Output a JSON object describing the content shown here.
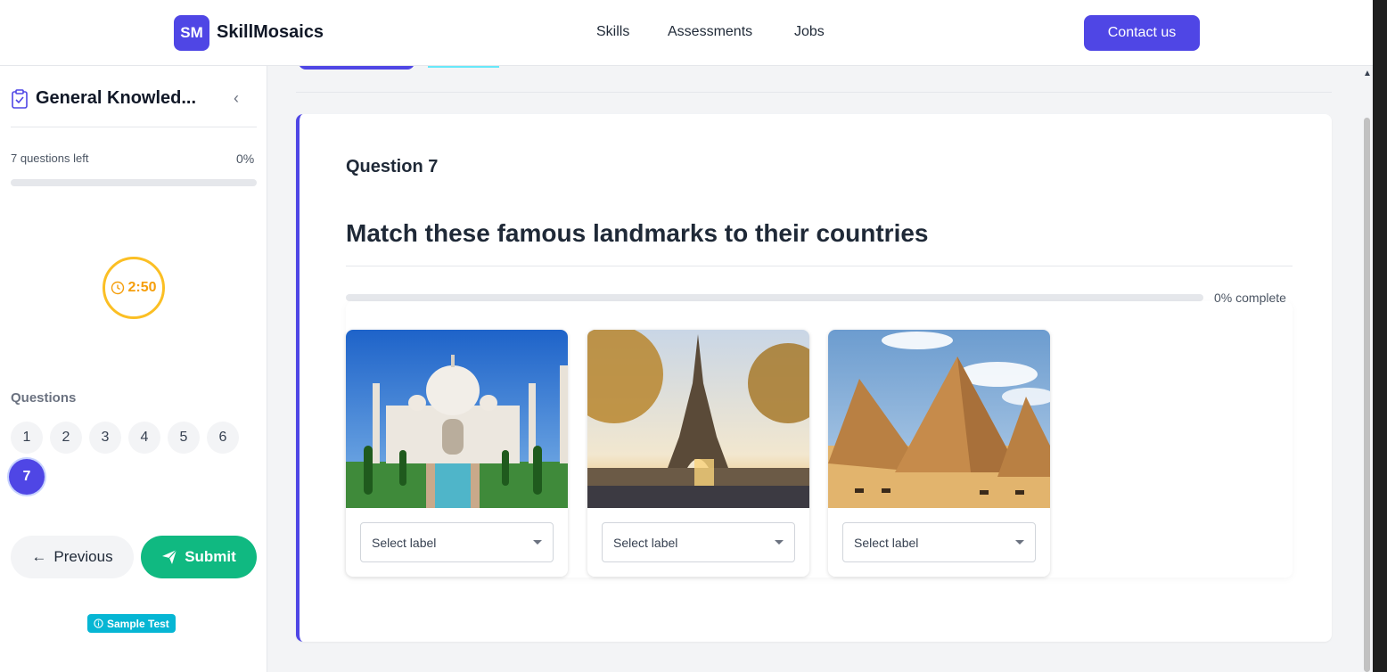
{
  "header": {
    "logo_initials": "SM",
    "brand": "SkillMosaics",
    "nav": {
      "skills": "Skills",
      "assessments": "Assessments",
      "jobs": "Jobs"
    },
    "contact_label": "Contact us"
  },
  "sidebar": {
    "test_title": "General Knowled...",
    "questions_left": "7 questions left",
    "percent": "0%",
    "progress_fraction": 0,
    "timer": "2:50",
    "questions_label": "Questions",
    "question_numbers": [
      "1",
      "2",
      "3",
      "4",
      "5",
      "6",
      "7"
    ],
    "active_question": "7",
    "previous_label": "Previous",
    "submit_label": "Submit",
    "sample_badge": "Sample Test"
  },
  "question": {
    "heading": "Question 7",
    "text": "Match these famous landmarks to their countries",
    "progress_label": "0% complete",
    "progress_fraction": 0,
    "items": [
      {
        "image": "taj-mahal",
        "select_placeholder": "Select label"
      },
      {
        "image": "eiffel-tower",
        "select_placeholder": "Select label"
      },
      {
        "image": "pyramids-of-giza",
        "select_placeholder": "Select label"
      }
    ]
  },
  "colors": {
    "primary": "#4f46e5",
    "success": "#10b981",
    "timer": "#fbbf24",
    "badge": "#06b6d4"
  }
}
